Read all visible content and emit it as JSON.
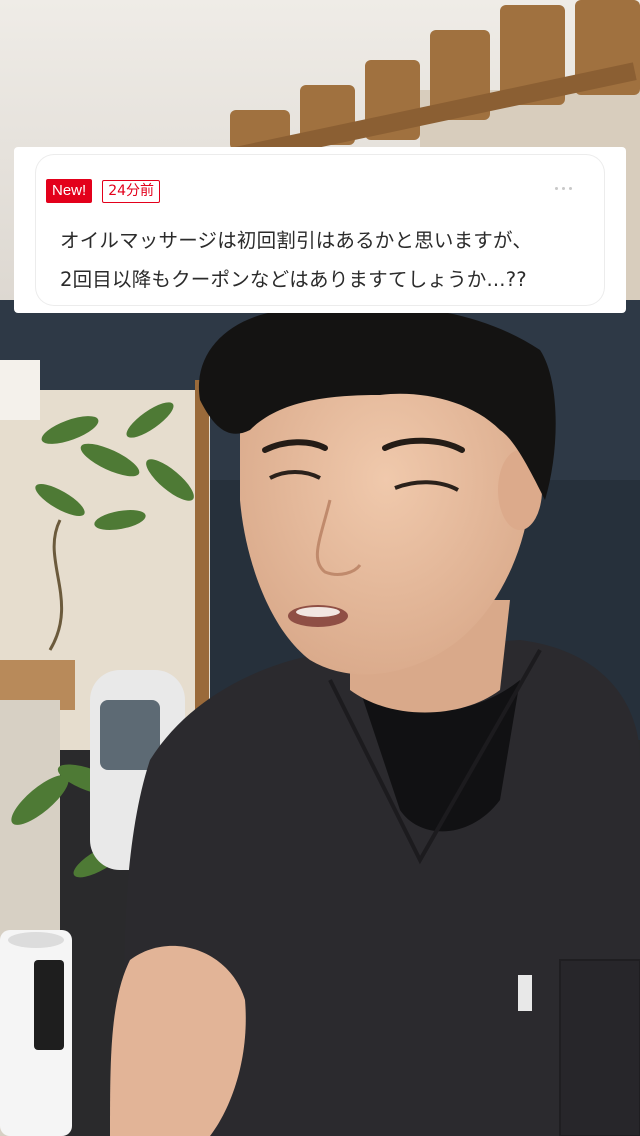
{
  "comment": {
    "new_badge": "New!",
    "time_badge": "24分前",
    "line1": "オイルマッサージは初回割引はあるかと思いますが、",
    "line2": "2回目以降もクーポンなどはありますてしょうか...??"
  },
  "icons": {
    "more": "more-horizontal-icon"
  },
  "colors": {
    "accent_red": "#e3001b",
    "card_bg": "#ffffff",
    "comment_text": "#2b2b2b",
    "scrubs": "#2b2a2e"
  }
}
